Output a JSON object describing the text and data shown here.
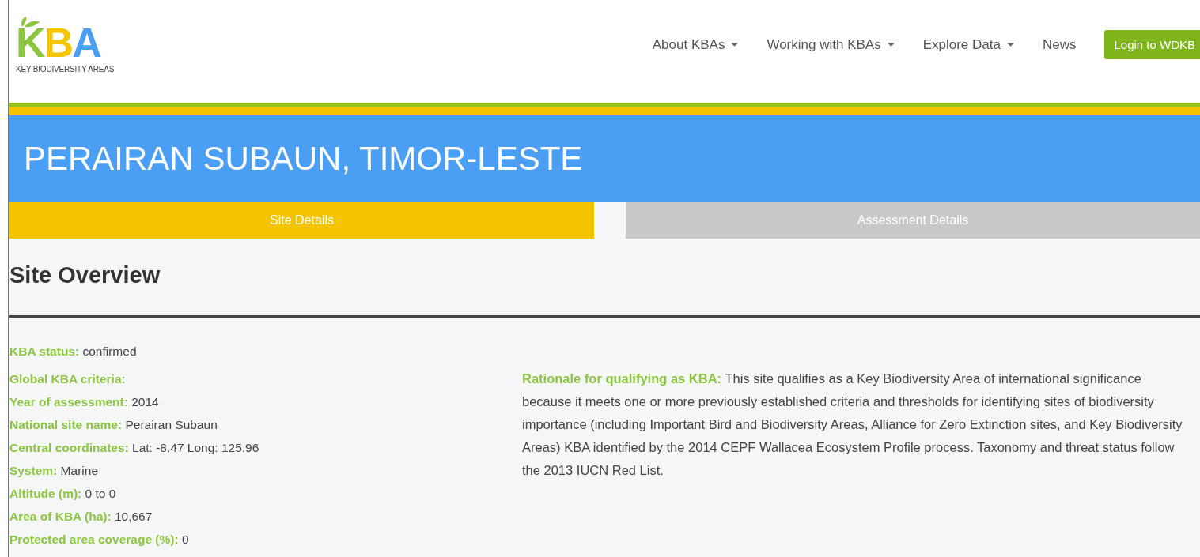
{
  "logo": {
    "letters": [
      {
        "text": "K",
        "color": "#8cc63f"
      },
      {
        "text": "B",
        "color": "#f5c400"
      },
      {
        "text": "A",
        "color": "#4a9ff5"
      }
    ],
    "tagline": "KEY BIODIVERSITY AREAS"
  },
  "nav": [
    {
      "label": "About KBAs",
      "dropdown": true
    },
    {
      "label": "Working with KBAs",
      "dropdown": true
    },
    {
      "label": "Explore Data",
      "dropdown": true
    },
    {
      "label": "News",
      "dropdown": false
    }
  ],
  "login_button": "Login to WDKB",
  "page_title": "PERAIRAN SUBAUN, TIMOR-LESTE",
  "tabs": [
    {
      "label": "Site Details",
      "selected": true
    },
    {
      "label": "Assessment Details",
      "selected": false
    }
  ],
  "section_title": "Site Overview",
  "status": {
    "label": "KBA status:",
    "value": "confirmed"
  },
  "fields": [
    {
      "label": "Global KBA criteria:"
    },
    {
      "label": "Year of assessment:",
      "value": "2014"
    },
    {
      "label": "National site name:",
      "value": "Perairan Subaun"
    },
    {
      "label": "Central coordinates:",
      "value": "Lat: -8.47 Long: 125.96"
    },
    {
      "label": "System:",
      "value": "Marine"
    },
    {
      "label": "Altitude (m):",
      "value": "0 to 0"
    },
    {
      "label": "Area of KBA (ha):",
      "value": "10,667"
    },
    {
      "label": "Protected area coverage (%):",
      "value": "0"
    }
  ],
  "rationale": {
    "label": "Rationale for qualifying as KBA:",
    "text": "This site qualifies as a Key Biodiversity Area of international significance because it meets one or more previously established criteria and thresholds for identifying sites of biodiversity importance (including Important Bird and Biodiversity Areas, Alliance for Zero Extinction sites, and Key Biodiversity Areas) KBA identified by the 2014 CEPF Wallacea Ecosystem Profile process. Taxonomy and threat status follow the 2013 IUCN Red List."
  }
}
